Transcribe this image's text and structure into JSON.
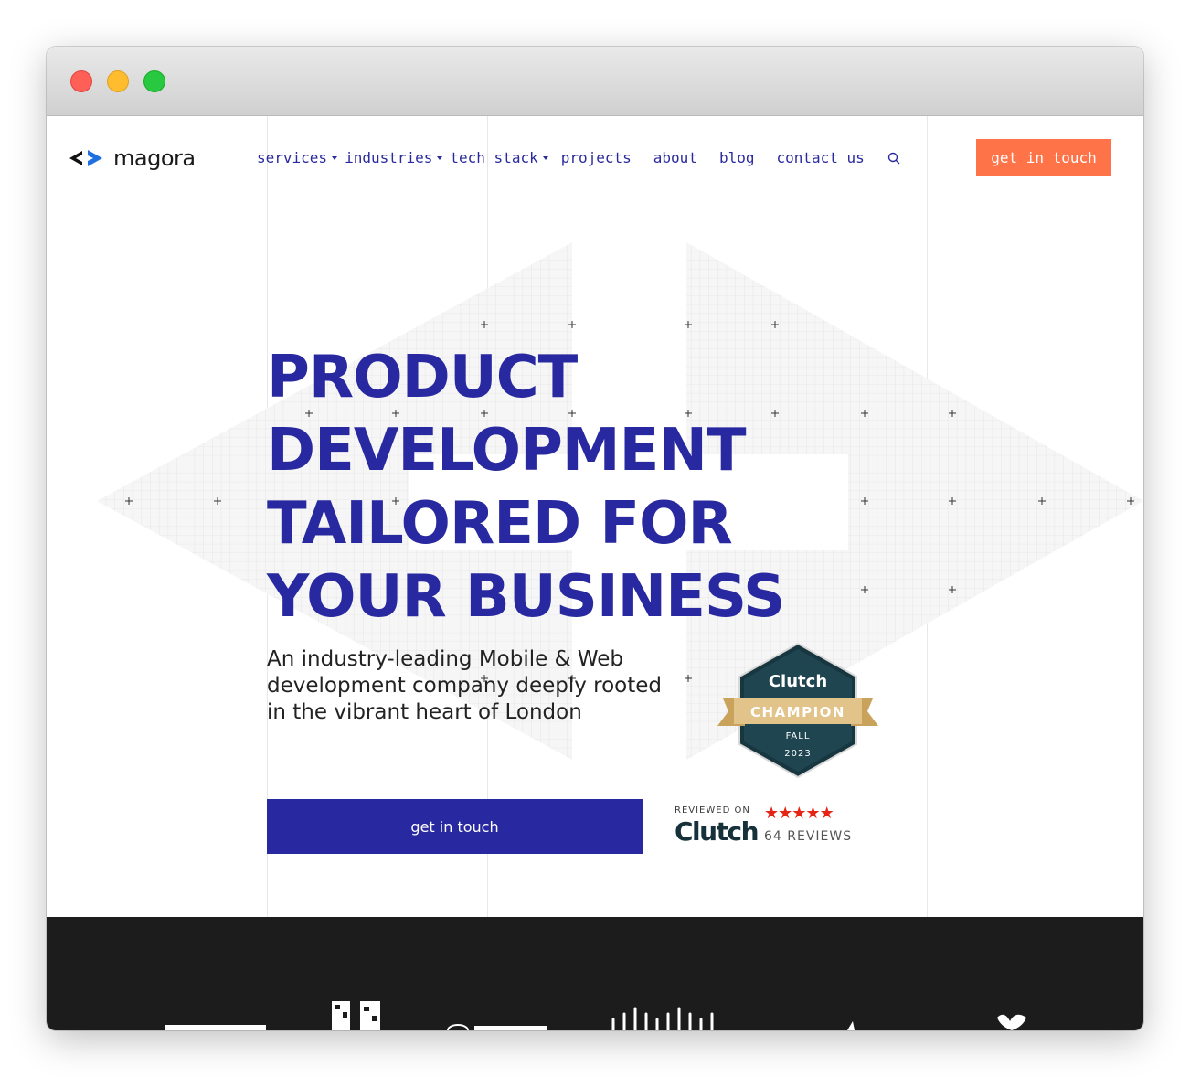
{
  "window": {
    "controls": [
      "close",
      "minimize",
      "zoom"
    ]
  },
  "nav": {
    "logo_text": "magora",
    "items": [
      {
        "label": "services",
        "dropdown": true
      },
      {
        "label": "industries",
        "dropdown": true
      },
      {
        "label": "tech stack",
        "dropdown": true
      },
      {
        "label": "projects",
        "dropdown": false
      },
      {
        "label": "about",
        "dropdown": false
      },
      {
        "label": "blog",
        "dropdown": false
      },
      {
        "label": "contact us",
        "dropdown": false
      }
    ],
    "search_icon": "search-icon",
    "cta_label": "get in touch"
  },
  "hero": {
    "title_lines": [
      "PRODUCT",
      "DEVELOPMENT",
      "TAILORED FOR",
      "YOUR BUSINESS"
    ],
    "subtitle": "An industry-leading Mobile & Web development company deeply rooted in the vibrant heart of London",
    "cta_label": "get in touch"
  },
  "badge": {
    "brand": "Clutch",
    "title": "CHAMPION",
    "season": "FALL",
    "year": "2023"
  },
  "review": {
    "label": "REVIEWED ON",
    "logo": "Clutch",
    "stars": 5,
    "count_text": "64 REVIEWS"
  },
  "clients": {
    "logos": [
      "danone-logo",
      "qr-logo",
      "toyota-logo",
      "cisco-logo",
      "bird-logo",
      "butterfly-logo"
    ]
  },
  "colors": {
    "primary": "#2828a0",
    "accent": "#ff7348",
    "dark": "#1c1c1c",
    "star": "#e62415"
  }
}
